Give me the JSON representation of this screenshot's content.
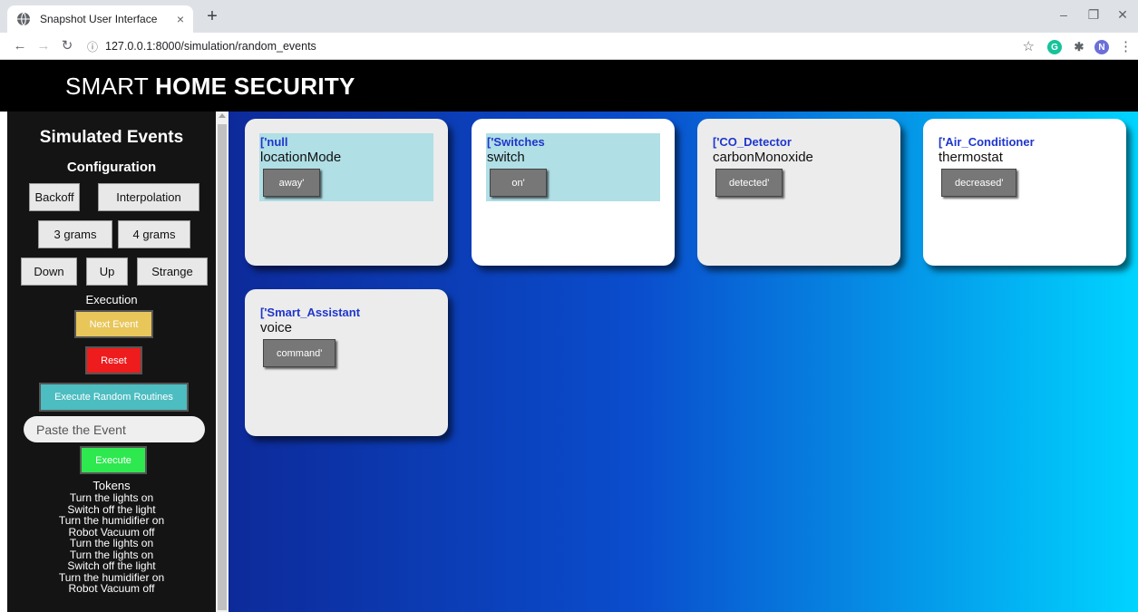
{
  "browser": {
    "tab_title": "Snapshot User Interface",
    "tab_close": "×",
    "new_tab": "+",
    "url": "127.0.0.1:8000/simulation/random_events",
    "profile_initial": "N",
    "ext_grammarly": "G"
  },
  "header": {
    "brand_light": "SMART",
    "brand_bold": "HOME SECURITY"
  },
  "sidebar": {
    "title": "Simulated Events",
    "config_label": "Configuration",
    "buttons": {
      "backoff": "Backoff",
      "interpolation": "Interpolation",
      "grams3": "3 grams",
      "grams4": "4 grams",
      "down": "Down",
      "up": "Up",
      "strange": "Strange"
    },
    "execution_label": "Execution",
    "next_event": "Next Event",
    "reset": "Reset",
    "execute_random": "Execute Random Routines",
    "paste_placeholder": "Paste the Event",
    "execute": "Execute",
    "tokens_label": "Tokens",
    "tokens": [
      "Turn the lights on",
      "Switch off the light",
      "Turn the humidifier on",
      "Robot Vacuum off",
      "Turn the lights on",
      "Turn the lights on",
      "Switch off the light",
      "Turn the humidifier on",
      "Robot Vacuum off"
    ]
  },
  "colors": {
    "next_event": "#e8c65a",
    "reset": "#ee1c1c",
    "execute_random": "#4cbdc1",
    "execute": "#2ee84f",
    "device_name": "#1f36cc",
    "highlight": "#b0dfe6"
  },
  "cards": [
    {
      "device": "['null",
      "attribute": "locationMode",
      "value": "away'"
    },
    {
      "device": "['Switches",
      "attribute": "switch",
      "value": "on'"
    },
    {
      "device": "['CO_Detector",
      "attribute": "carbonMonoxide",
      "value": "detected'"
    },
    {
      "device": "['Air_Conditioner",
      "attribute": "thermostat",
      "value": "decreased'"
    },
    {
      "device": "['Smart_Assistant",
      "attribute": "voice",
      "value": "command'"
    }
  ]
}
